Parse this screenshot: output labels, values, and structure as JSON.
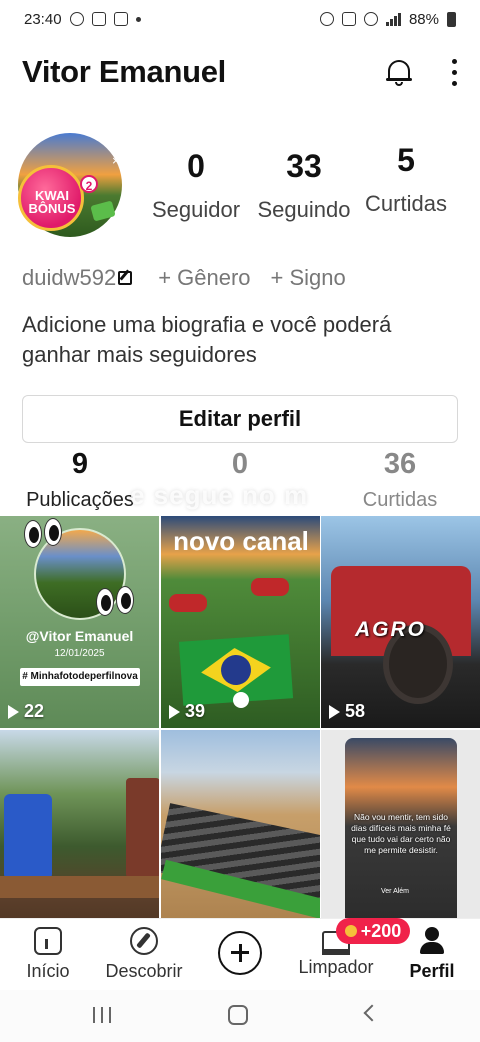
{
  "status_bar": {
    "time": "23:40",
    "battery": "88%"
  },
  "header": {
    "name": "Vitor Emanuel"
  },
  "avatar": {
    "badge_text": "KWAI BÔNUS",
    "badge_count": "2",
    "close_symbol": "×"
  },
  "stats": [
    {
      "value": "0",
      "label": "Seguidor"
    },
    {
      "value": "33",
      "label": "Seguindo"
    },
    {
      "value": "5",
      "label": "Curtidas"
    }
  ],
  "info": {
    "username": "duidw592",
    "gender": "+ Gênero",
    "sign": "+ Signo"
  },
  "bio": "Adicione uma biografia e você poderá ganhar mais seguidores",
  "edit_button": "Editar perfil",
  "tab_stats": [
    {
      "value": "9",
      "label": "Publicações"
    },
    {
      "value": "0",
      "label": ""
    },
    {
      "value": "36",
      "label": "Curtidas"
    }
  ],
  "overlay_text": "e segue no m",
  "grid": [
    {
      "views": "22",
      "handle": "@Vitor Emanuel",
      "date": "12/01/2025",
      "tag": "# Minhafotodeperfilnova"
    },
    {
      "views": "39",
      "title": "novo canal"
    },
    {
      "views": "58",
      "text": "AGRO"
    },
    {
      "views": ""
    },
    {
      "views": ""
    },
    {
      "views": "",
      "text": "Não vou mentir, tem sido dias difíceis mais minha fé que tudo vai dar certo não me permite desistir.",
      "sign": "Ver Além"
    }
  ],
  "badge": "+200",
  "bottom_nav": [
    {
      "label": "Início"
    },
    {
      "label": "Descobrir"
    },
    {
      "label": "Limpador"
    },
    {
      "label": "Perfil"
    }
  ],
  "colors": {
    "accent": "#f0224a",
    "text": "#111111",
    "muted": "#777777"
  }
}
